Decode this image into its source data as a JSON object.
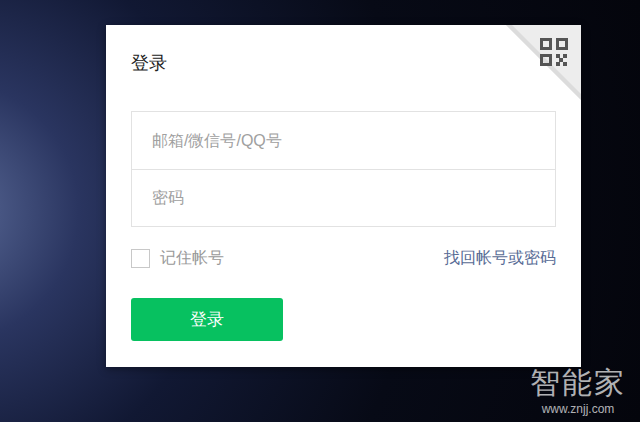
{
  "dialog": {
    "title": "登录"
  },
  "fields": [
    {
      "placeholder": "邮箱/微信号/QQ号",
      "kind": "text"
    },
    {
      "placeholder": "密码",
      "kind": "password"
    }
  ],
  "remember": {
    "label": "记住帐号",
    "checked": false
  },
  "recover_link": "找回帐号或密码",
  "login_button": "登录",
  "watermark": {
    "brand": "智能家",
    "url": "www.znjj.com"
  }
}
